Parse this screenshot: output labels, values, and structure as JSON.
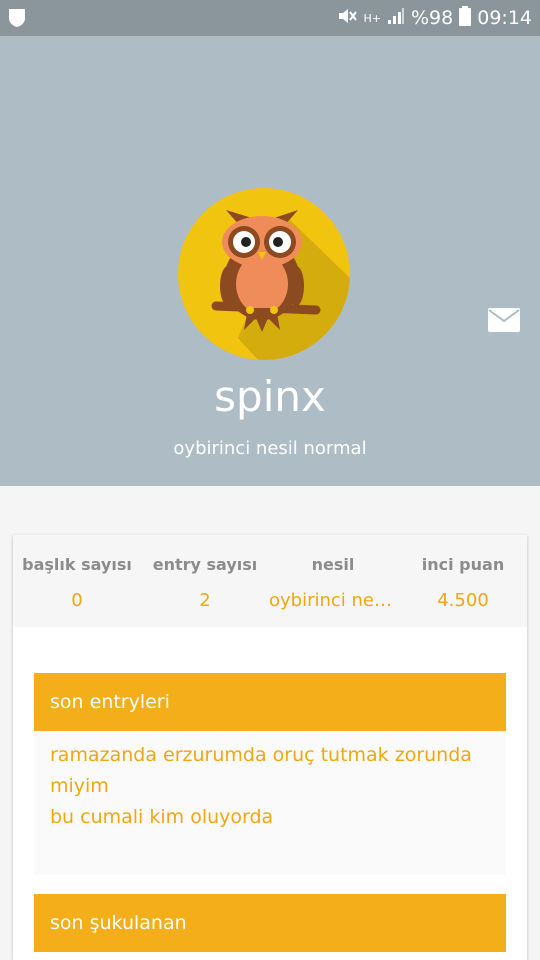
{
  "statusbar": {
    "network": "H+",
    "battery_percent": "%98",
    "time": "09:14"
  },
  "profile": {
    "username": "spinx",
    "subtitle": "oybirinci nesil normal"
  },
  "stats": [
    {
      "label": "başlık sayısı",
      "value": "0"
    },
    {
      "label": "entry sayısı",
      "value": "2"
    },
    {
      "label": "nesil",
      "value": "oybirinci nesil normal"
    },
    {
      "label": "inci puan",
      "value": "4.500"
    }
  ],
  "sections": {
    "latest_entries": {
      "title": "son entryleri",
      "items": [
        "ramazanda erzurumda oruç tutmak zorunda miyim",
        "bu cumali kim oluyorda"
      ]
    },
    "favorited": {
      "title": "son şukulanan"
    }
  },
  "colors": {
    "header_bg": "#adbcc5",
    "accent": "#f3ae19",
    "value_text": "#f2a60f"
  }
}
